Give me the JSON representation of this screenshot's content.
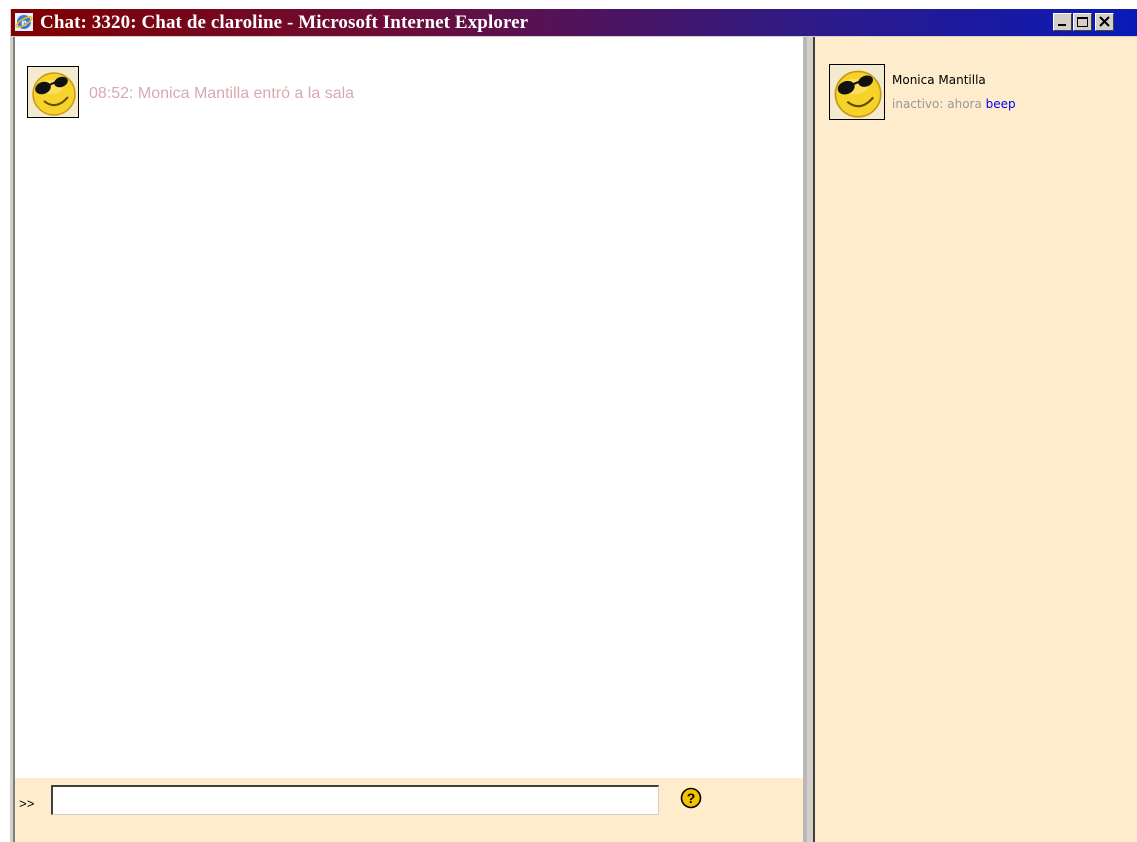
{
  "window": {
    "title": "Chat: 3320: Chat de claroline - Microsoft Internet Explorer",
    "icon": "ie-icon",
    "controls": [
      "minimize-icon",
      "maximize-icon",
      "close-icon"
    ]
  },
  "chat": {
    "messages": [
      {
        "avatar_icon": "smiley-sunglasses-icon",
        "text": "08:52: Monica Mantilla entró a la sala"
      }
    ],
    "input": {
      "prompt": ">>",
      "value": "",
      "help_icon": "help-icon"
    }
  },
  "users": [
    {
      "avatar_icon": "smiley-sunglasses-icon",
      "name": "Monica Mantilla",
      "status": "inactivo: ahora",
      "beep_label": "beep"
    }
  ],
  "colors": {
    "users_pane_bg": "#ffeccc",
    "system_message": "#d9a9b0",
    "link": "#0000ee"
  }
}
